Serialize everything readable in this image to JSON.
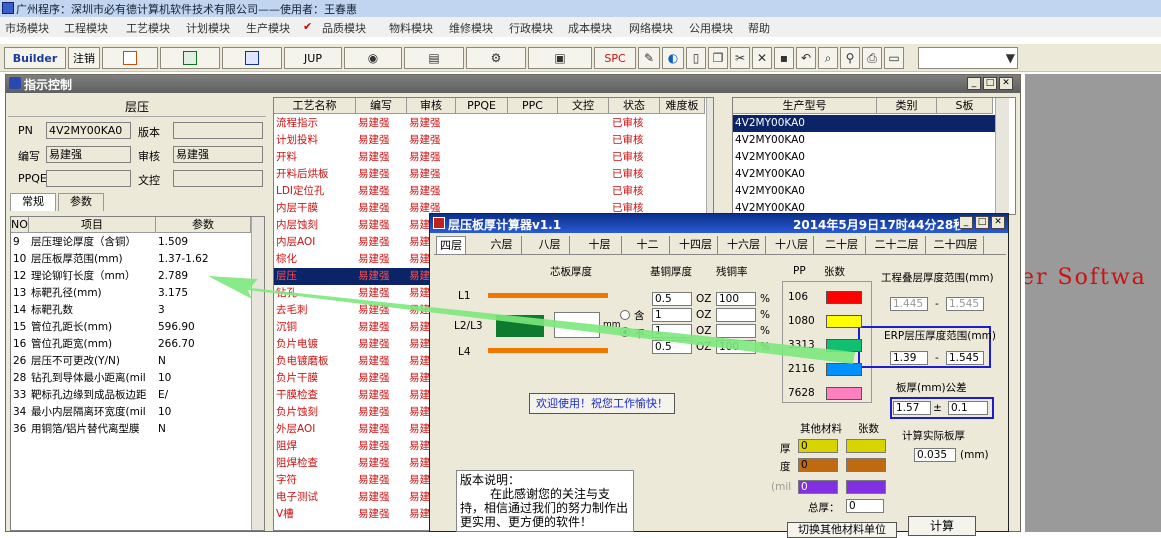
{
  "app_title": "广州程序：深圳市必有德计算机软件技术有限公司——使用者：王春惠",
  "menu": [
    "市场模块",
    "工程模块",
    "工艺模块",
    "计划模块",
    "生产模块",
    "品质模块",
    "物料模块",
    "维修模块",
    "行政模块",
    "成本模块",
    "网络模块",
    "公用模块",
    "帮助"
  ],
  "toolbar": {
    "builder": "Builder",
    "logout": "注销",
    "jup": "JUP",
    "spc": "SPC"
  },
  "main_window": {
    "title": "指示控制"
  },
  "left_panel": {
    "heading": "层压",
    "pn_label": "PN",
    "pn_value": "4V2MY00KA0",
    "version_label": "版本",
    "version_value": "",
    "author_label": "编写",
    "author_value": "易建强",
    "review_label": "审核",
    "review_value": "易建强",
    "ppqe_label": "PPQE",
    "ppqe_value": "",
    "control_label": "文控",
    "control_value": "",
    "tab_general": "常规",
    "tab_params": "参数",
    "grid_headers": [
      "NO",
      "项目",
      "参数"
    ],
    "rows": [
      {
        "no": "9",
        "item": "层压理论厚度（含铜）",
        "val": "1.509"
      },
      {
        "no": "10",
        "item": "层压板厚范围(mm)",
        "val": "1.37-1.62"
      },
      {
        "no": "12",
        "item": "理论铆钉长度（mm）",
        "val": "2.789"
      },
      {
        "no": "13",
        "item": "标靶孔径(mm)",
        "val": "3.175"
      },
      {
        "no": "14",
        "item": "标靶孔数",
        "val": "3"
      },
      {
        "no": "15",
        "item": "管位孔距长(mm)",
        "val": "596.90"
      },
      {
        "no": "16",
        "item": "管位孔距宽(mm)",
        "val": "266.70"
      },
      {
        "no": "26",
        "item": "层压不可更改(Y/N)",
        "val": "N"
      },
      {
        "no": "28",
        "item": "钻孔到导体最小距离(mil",
        "val": "10"
      },
      {
        "no": "33",
        "item": "靶标孔边缘到成品板边距",
        "val": "E/"
      },
      {
        "no": "34",
        "item": "最小内层隔离环宽度(mil",
        "val": "10"
      },
      {
        "no": "36",
        "item": "用铜箔/铝片替代离型膜",
        "val": "N"
      }
    ]
  },
  "process_table": {
    "headers": [
      "工艺名称",
      "编写",
      "审核",
      "PPQE",
      "PPC",
      "文控",
      "状态",
      "难度板"
    ],
    "rows": [
      {
        "name": "流程指示",
        "w": "易建强",
        "r": "易建强",
        "s": "已审核"
      },
      {
        "name": "计划投料",
        "w": "易建强",
        "r": "易建强",
        "s": "已审核"
      },
      {
        "name": "开料",
        "w": "易建强",
        "r": "易建强",
        "s": "已审核"
      },
      {
        "name": "开料后烘板",
        "w": "易建强",
        "r": "易建强",
        "s": "已审核"
      },
      {
        "name": "LDI定位孔",
        "w": "易建强",
        "r": "易建强",
        "s": "已审核"
      },
      {
        "name": "内层干膜",
        "w": "易建强",
        "r": "易建强",
        "s": "已审核"
      },
      {
        "name": "内层蚀刻",
        "w": "易建强",
        "r": "易建",
        "s": ""
      },
      {
        "name": "内层AOI",
        "w": "易建强",
        "r": "易建",
        "s": ""
      },
      {
        "name": "棕化",
        "w": "易建强",
        "r": "易建",
        "s": ""
      },
      {
        "name": "层压",
        "w": "易建强",
        "r": "易建",
        "s": ""
      },
      {
        "name": "钻孔",
        "w": "易建强",
        "r": "易建",
        "s": ""
      },
      {
        "name": "去毛刺",
        "w": "易建强",
        "r": "易建",
        "s": ""
      },
      {
        "name": "沉铜",
        "w": "易建强",
        "r": "易建",
        "s": ""
      },
      {
        "name": "负片电镀",
        "w": "易建强",
        "r": "易建",
        "s": ""
      },
      {
        "name": "负电镀磨板",
        "w": "易建强",
        "r": "易建",
        "s": ""
      },
      {
        "name": "负片干膜",
        "w": "易建强",
        "r": "易建",
        "s": ""
      },
      {
        "name": "干膜检查",
        "w": "易建强",
        "r": "易建",
        "s": ""
      },
      {
        "name": "负片蚀刻",
        "w": "易建强",
        "r": "易建",
        "s": ""
      },
      {
        "name": "外层AOI",
        "w": "易建强",
        "r": "易建",
        "s": ""
      },
      {
        "name": "阻焊",
        "w": "易建强",
        "r": "易建",
        "s": ""
      },
      {
        "name": "阻焊检查",
        "w": "易建强",
        "r": "易建",
        "s": ""
      },
      {
        "name": "字符",
        "w": "易建强",
        "r": "易建",
        "s": ""
      },
      {
        "name": "电子测试",
        "w": "易建强",
        "r": "易建",
        "s": ""
      },
      {
        "name": "V槽",
        "w": "易建强",
        "r": "易建",
        "s": ""
      }
    ]
  },
  "model_table": {
    "headers": [
      "生产型号",
      "类别",
      "S板"
    ],
    "rows": [
      "4V2MY00KA0",
      "4V2MY00KA0",
      "4V2MY00KA0",
      "4V2MY00KA0",
      "4V2MY00KA0",
      "4V2MY00KA0"
    ]
  },
  "bg_text": "er Softwa",
  "calc": {
    "title": "层压板厚计算器v1.1",
    "datetime": "2014年5月9日17时44分28秒",
    "tabs": [
      "四层",
      "六层",
      "八层",
      "十层",
      "十二",
      "十四层",
      "十六层",
      "十八层",
      "二十层",
      "二十二层",
      "二十四层"
    ],
    "core_thickness": "芯板厚度",
    "base_copper": "基铜厚度",
    "residual": "残铜率",
    "pp": "PP",
    "sheets": "张数",
    "L1": "L1",
    "L2L3": "L2/L3",
    "L4": "L4",
    "mm": "mm",
    "incl": "含",
    "not_incl": "不",
    "oz": "OZ",
    "pct": "%",
    "copper": [
      "0.5",
      "1",
      "1",
      "0.5"
    ],
    "residual_vals": [
      "100",
      "",
      "",
      "100"
    ],
    "pp_types": [
      "106",
      "1080",
      "3313",
      "2116",
      "7628"
    ],
    "pp_colors": [
      "#ff0000",
      "#ffff00",
      "#10c070",
      "#0090ff",
      "#ff80c0"
    ],
    "eng_range_label": "工程叠层厚度范围(mm)",
    "eng_min": "1.445",
    "eng_max": "1.545",
    "erp_range_label": "ERP层压厚度范围(mm)",
    "erp_min": "1.39",
    "erp_max": "1.545",
    "thickness_label": "板厚(mm)公差",
    "thickness": "1.57",
    "pm": "±",
    "tolerance": "0.1",
    "calc_actual_label": "计算实际板厚",
    "actual": "0.035",
    "actual_unit": "(mm)",
    "welcome": "欢迎使用！祝您工作愉快！",
    "other_materials": "其他材料",
    "other_sheets": "张数",
    "thick_label": "厚",
    "degree_label": "度",
    "mil_label": "(mil",
    "other_vals": [
      "0",
      "0",
      "0"
    ],
    "total_label": "总厚：",
    "total_val": "0",
    "version_title": "版本说明：",
    "version_text": "在此感谢您的关注与支持，相信通过我们的努力制作出更实用、更方便的软件！",
    "switch_btn": "切换其他材料单位",
    "calc_btn": "计算"
  }
}
